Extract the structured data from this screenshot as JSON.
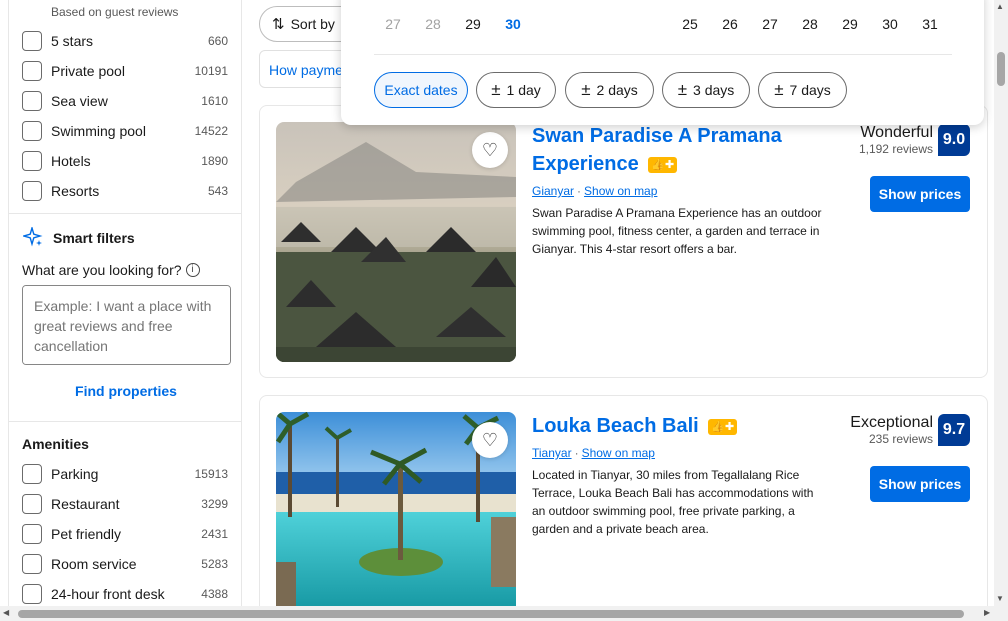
{
  "sidebar": {
    "popular_caption": "Based on guest reviews",
    "popular_filters": [
      {
        "label": "5 stars",
        "count": "660"
      },
      {
        "label": "Private pool",
        "count": "10191"
      },
      {
        "label": "Sea view",
        "count": "1610"
      },
      {
        "label": "Swimming pool",
        "count": "14522"
      },
      {
        "label": "Hotels",
        "count": "1890"
      },
      {
        "label": "Resorts",
        "count": "543"
      }
    ],
    "smart_filters": {
      "title": "Smart filters",
      "question": "What are you looking for?",
      "placeholder": "Example: I want a place with great reviews and free cancellation",
      "find_button": "Find properties"
    },
    "amenities": {
      "title": "Amenities",
      "items": [
        {
          "label": "Parking",
          "count": "15913"
        },
        {
          "label": "Restaurant",
          "count": "3299"
        },
        {
          "label": "Pet friendly",
          "count": "2431"
        },
        {
          "label": "Room service",
          "count": "5283"
        },
        {
          "label": "24-hour front desk",
          "count": "4388"
        }
      ]
    }
  },
  "toolbar": {
    "sort_label": "Sort by",
    "how_payment_label": "How payme"
  },
  "date_popup": {
    "left_month_days": [
      "27",
      "28",
      "29",
      "30"
    ],
    "right_month_days": [
      "25",
      "26",
      "27",
      "28",
      "29",
      "30",
      "31"
    ],
    "selected_day": "30",
    "flex_options": [
      {
        "label": "Exact dates",
        "prefix": ""
      },
      {
        "label": "1 day",
        "prefix": "±"
      },
      {
        "label": "2 days",
        "prefix": "±"
      },
      {
        "label": "3 days",
        "prefix": "±"
      },
      {
        "label": "7 days",
        "prefix": "±"
      }
    ]
  },
  "listings": [
    {
      "name_line1": "Swan Paradise A Pramana",
      "name_line2": "Experience",
      "genius_badge": "👍✚",
      "location": "Gianyar",
      "map_link": "Show on map",
      "description": "Swan Paradise A Pramana Experience has an outdoor swimming pool, fitness center, a garden and terrace in Gianyar. This 4-star resort offers a bar.",
      "rating_word": "Wonderful",
      "reviews": "1,192 reviews",
      "score": "9.0",
      "cta": "Show prices"
    },
    {
      "name_line1": "Louka Beach Bali",
      "genius_badge": "👍✚",
      "location": "Tianyar",
      "map_link": "Show on map",
      "description": "Located in Tianyar, 30 miles from Tegallalang Rice Terrace, Louka Beach Bali has accommodations with an outdoor swimming pool, free private parking, a garden and a private beach area.",
      "rating_word": "Exceptional",
      "reviews": "235 reviews",
      "score": "9.7",
      "cta": "Show prices"
    }
  ],
  "colors": {
    "brand_blue": "#006ce4",
    "score_blue": "#003b95",
    "genius_yellow": "#ffb700"
  },
  "icons": {
    "sort": "sort-arrows-icon",
    "smart": "sparkle-icon",
    "info": "info-icon",
    "favorite": "heart-icon"
  }
}
